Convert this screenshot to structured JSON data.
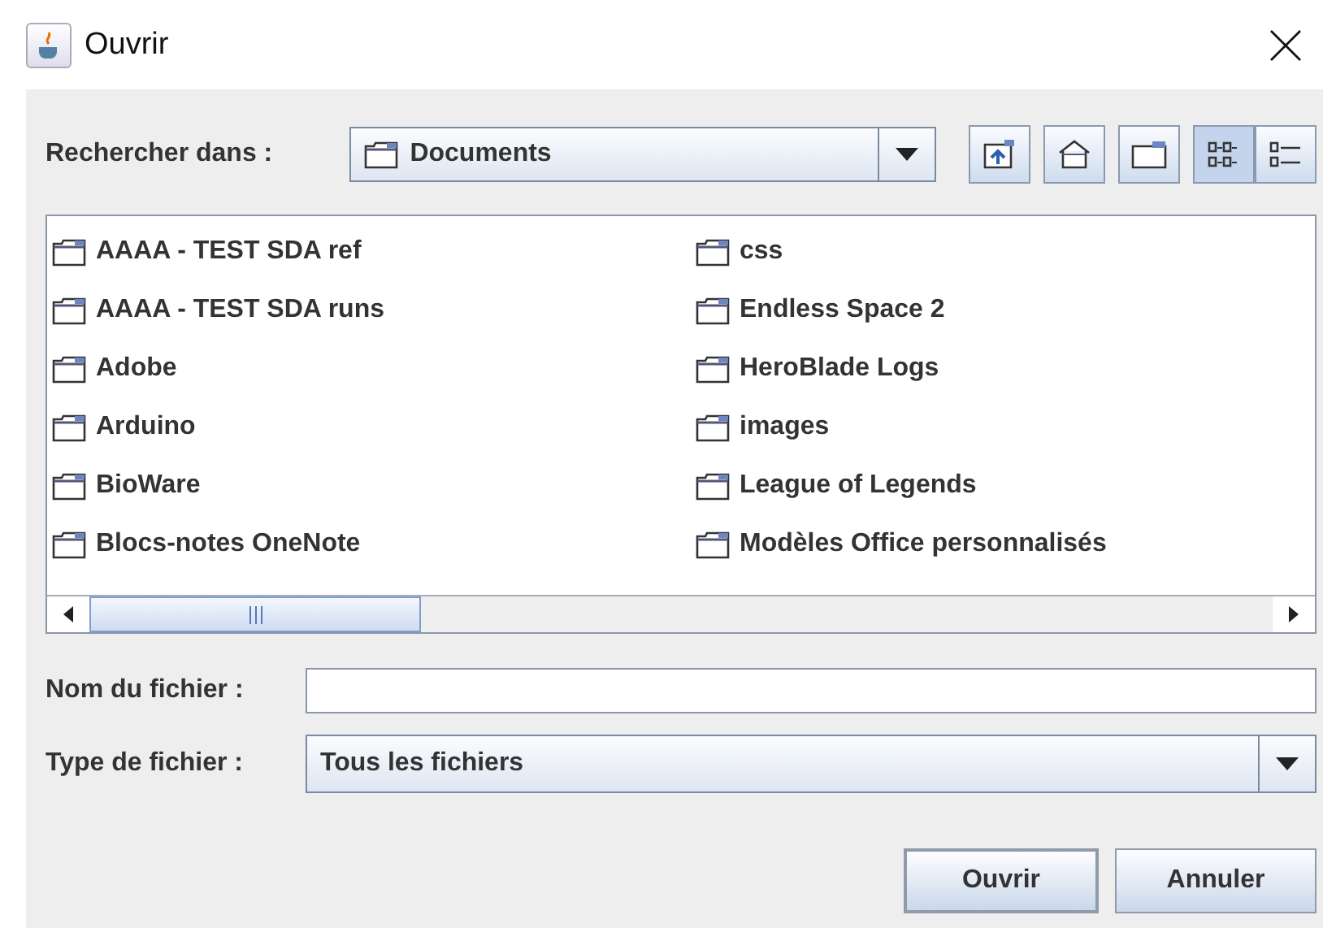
{
  "window": {
    "title": "Ouvrir"
  },
  "look_in": {
    "label": "Rechercher dans :",
    "value": "Documents"
  },
  "toolbar": [
    {
      "kind": "up"
    },
    {
      "kind": "home"
    },
    {
      "kind": "new-folder"
    },
    {
      "kind": "list-view",
      "selected": true
    },
    {
      "kind": "details-view",
      "selected": false
    }
  ],
  "files": [
    {
      "name": "AAAA - TEST SDA ref"
    },
    {
      "name": "AAAA - TEST SDA runs"
    },
    {
      "name": "Adobe"
    },
    {
      "name": "Arduino"
    },
    {
      "name": "BioWare"
    },
    {
      "name": "Blocs-notes OneNote"
    },
    {
      "name": "css"
    },
    {
      "name": "Endless Space 2"
    },
    {
      "name": "HeroBlade Logs"
    },
    {
      "name": "images"
    },
    {
      "name": "League of Legends"
    },
    {
      "name": "Modèles Office personnalisés"
    }
  ],
  "file_name": {
    "label": "Nom du fichier :"
  },
  "file_type": {
    "label": "Type de fichier :",
    "value": "Tous les fichiers"
  },
  "buttons": [
    "Ouvrir",
    "Annuler"
  ]
}
